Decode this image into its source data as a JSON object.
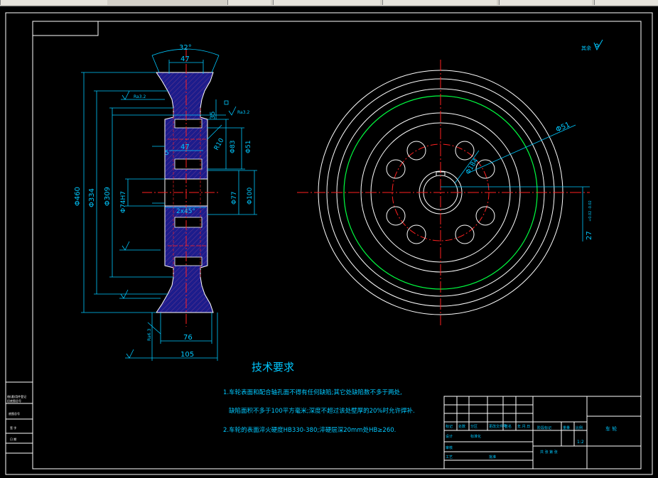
{
  "tech_requirements": {
    "title": "技术要求",
    "line1": "1.车轮表面和配合轴孔面不得有任何缺陷;其它处缺陷数不多于两处,",
    "line2": "缺陷面积不多于100平方毫米;深度不超过该处壁厚的20%时允许焊补.",
    "line3": "2.车轮的表面淬火硬度HB330-380;淬硬层深20mm处HB≥260."
  },
  "section_view": {
    "angle": "32°",
    "dim_top_47": "47",
    "dim_mid_47": "47",
    "dim_35": "35",
    "dim_r10": "R10",
    "dim_d83": "Φ83",
    "dim_d51": "Φ51",
    "dim_d77": "Φ77",
    "dim_d100": "Φ100",
    "dim_d460": "Φ460",
    "dim_d334": "Φ334",
    "dim_d309": "Φ309",
    "dim_bore": "Φ74H7",
    "chamfer": "2x45°",
    "dim_76": "76",
    "dim_105": "105",
    "rough_32": "Ra3.2",
    "rough_32b": "Ra3.2",
    "rough_63": "Ra6.3",
    "small_5": "5"
  },
  "front_view": {
    "dim_d51": "Φ51",
    "dim_d184": "Φ184",
    "dim_27": "27",
    "tolerance": "+0.02 -0.02"
  },
  "rough_note": "其余",
  "title_block": {
    "part_name": "车 轮",
    "scale": "1:2",
    "row_labels": [
      "标记",
      "处数",
      "分区",
      "更改文件号",
      "签名",
      "年.月.日"
    ],
    "designer": "设计",
    "checker": "审核",
    "process": "工艺",
    "approve": "批准",
    "std": "标准化",
    "stage": "阶段标记",
    "weight": "重量",
    "ratio": "比例",
    "sheets": "共 张 第 张"
  },
  "side_block": [
    "借(通)用件登记",
    "旧底图总号",
    "底图总号",
    "签 字",
    "日 期"
  ],
  "colors": {
    "background": "#000000",
    "line_white": "#ffffff",
    "dim_cyan": "#00c8ff",
    "center_red": "#ff2020",
    "green": "#00ff40",
    "hatch_blue": "#2020a0"
  }
}
